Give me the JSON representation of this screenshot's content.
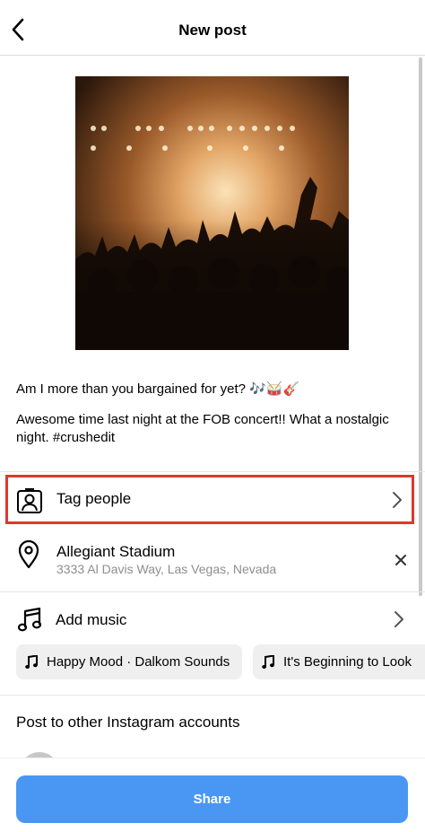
{
  "header": {
    "title": "New post",
    "back_icon": "chevron-left-icon"
  },
  "post": {
    "image_description": "concert-crowd-photo",
    "caption_line1": "Am I more than you bargained for yet? 🎶🥁🎸",
    "caption_line2": "Awesome time last night at the FOB concert!! What a nostalgic night. #crushedit"
  },
  "options": {
    "tag_people": {
      "label": "Tag people",
      "icon": "tag-person-icon",
      "highlighted": true,
      "highlight_color": "#e0372c"
    },
    "location": {
      "name": "Allegiant Stadium",
      "address": "3333 Al Davis Way, Las Vegas, Nevada",
      "icon": "location-pin-icon",
      "remove_icon": "close-icon"
    },
    "music": {
      "label": "Add music",
      "icon": "music-note-icon",
      "suggestions": [
        {
          "label": "Happy Mood · Dalkom Sounds"
        },
        {
          "label": "It's Beginning to Look"
        }
      ]
    }
  },
  "other_accounts": {
    "title": "Post to other Instagram accounts"
  },
  "footer": {
    "share_label": "Share",
    "accent_color": "#4a97f3"
  }
}
